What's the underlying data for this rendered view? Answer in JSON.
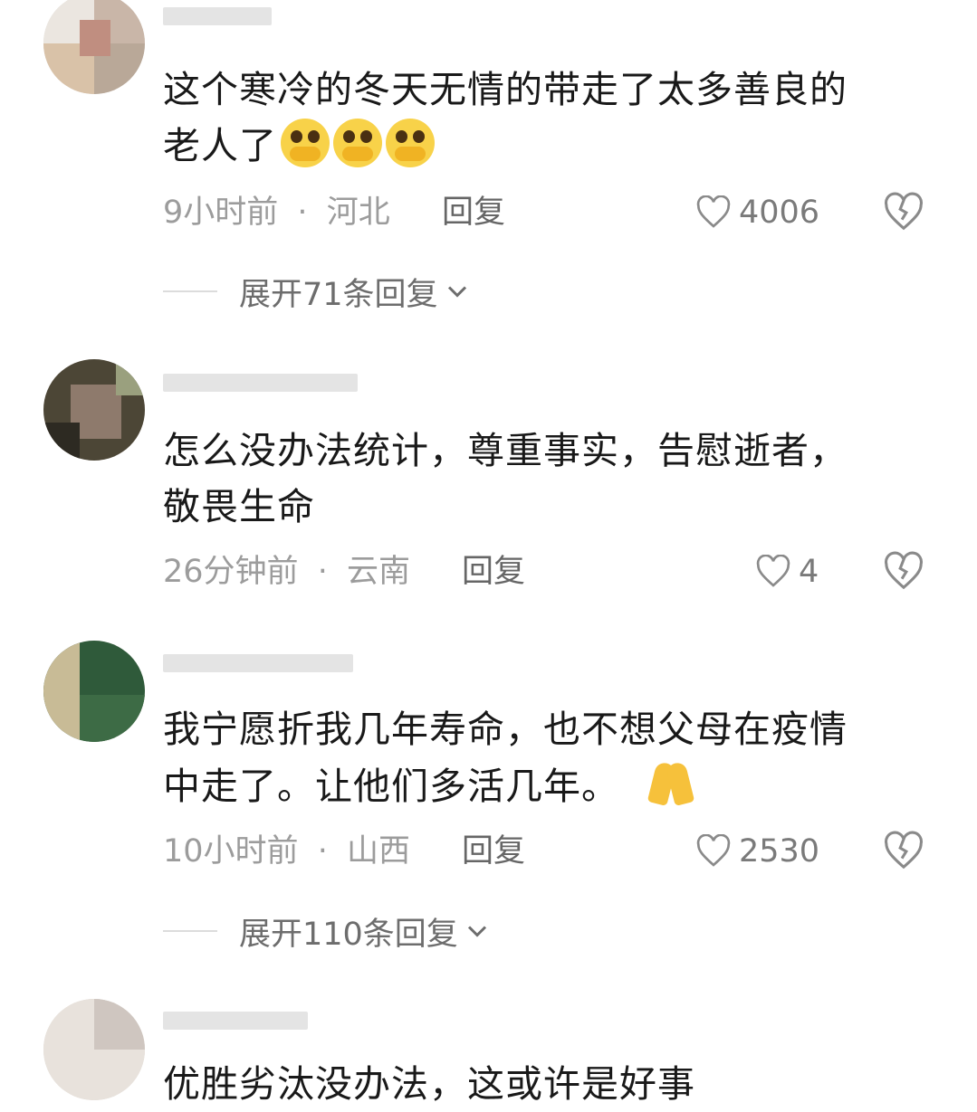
{
  "comments": [
    {
      "text_lines": [
        "这个寒冷的冬天无情的带走了太多善良的",
        "老人了"
      ],
      "emoji": [
        "pleading-face-emoji",
        "pleading-face-emoji",
        "pleading-face-emoji"
      ],
      "time": "9小时前",
      "region": "河北",
      "reply_label": "回复",
      "likes": "4006",
      "expand_label": "展开71条回复"
    },
    {
      "text_lines": [
        "怎么没办法统计，尊重事实，告慰逝者，",
        "敬畏生命"
      ],
      "time": "26分钟前",
      "region": "云南",
      "reply_label": "回复",
      "likes": "4"
    },
    {
      "text_lines": [
        "我宁愿折我几年寿命，也不想父母在疫情",
        "中走了。让他们多活几年。"
      ],
      "emoji": [
        "folded-hands-emoji"
      ],
      "time": "10小时前",
      "region": "山西",
      "reply_label": "回复",
      "likes": "2530",
      "expand_label": "展开110条回复"
    },
    {
      "text_lines": [
        "优胜劣汰没办法，这或许是好事"
      ]
    }
  ],
  "separator": "·",
  "colors": {
    "meta": "#9c9c9c",
    "text": "#191919",
    "emoji": "#f8d249"
  }
}
